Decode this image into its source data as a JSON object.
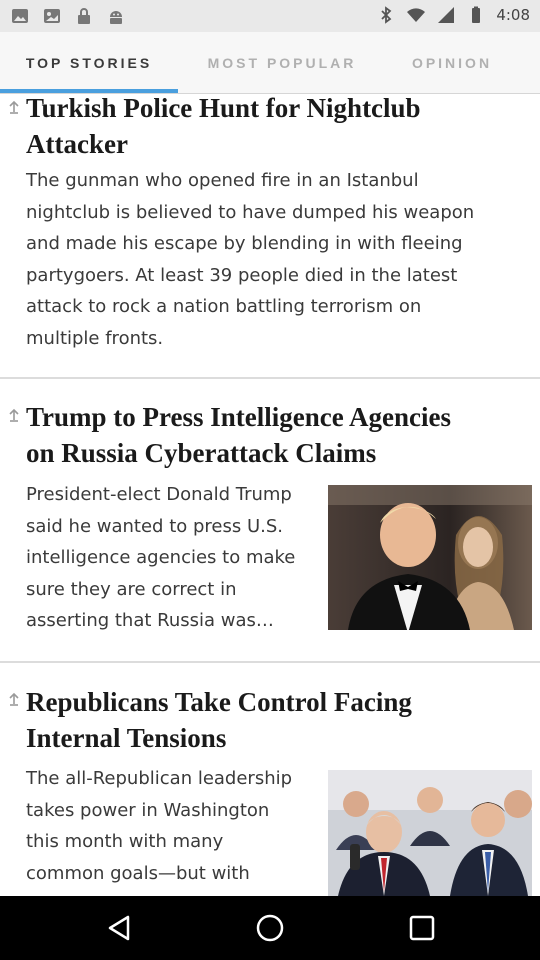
{
  "status_bar": {
    "time": "4:08",
    "left_icons": [
      "gallery-icon",
      "image-icon",
      "lock-icon",
      "android-icon"
    ],
    "right_icons": [
      "bluetooth-icon",
      "wifi-icon",
      "signal-icon",
      "battery-icon"
    ]
  },
  "tabs": [
    {
      "label": "TOP STORIES",
      "active": true
    },
    {
      "label": "MOST POPULAR",
      "active": false
    },
    {
      "label": "OPINION",
      "active": false
    }
  ],
  "articles": [
    {
      "headline_lines": [
        "Turkish Police Hunt for Nightclub",
        "Attacker"
      ],
      "summary_lines": [
        "The gunman who opened fire in an Istanbul",
        "nightclub is believed to have dumped his weapon",
        "and made his escape by blending in with fleeing",
        "partygoers. At least 39 people died in the latest",
        "attack to rock a nation battling terrorism on",
        "multiple fronts."
      ],
      "has_image": false
    },
    {
      "headline_lines": [
        "Trump to Press Intelligence Agencies",
        "on Russia Cyberattack Claims"
      ],
      "summary_lines": [
        "President-elect Donald Trump",
        "said he wanted to press U.S.",
        "intelligence agencies to make",
        "sure they are correct in",
        "asserting that Russia was…"
      ],
      "has_image": true
    },
    {
      "headline_lines": [
        "Republicans Take Control Facing",
        "Internal Tensions"
      ],
      "summary_lines": [
        "The all-Republican leadership",
        "takes power in Washington",
        "this month with many",
        "common goals—but with"
      ],
      "has_image": true
    }
  ],
  "nav_bar": {
    "buttons": [
      "back-icon",
      "home-icon",
      "recents-icon"
    ]
  },
  "colors": {
    "accent": "#4a9fde",
    "tab_active": "#3a3a3a",
    "tab_inactive": "#b0b0b0",
    "headline": "#1a1a1a",
    "body_text": "#3a3a3a"
  }
}
